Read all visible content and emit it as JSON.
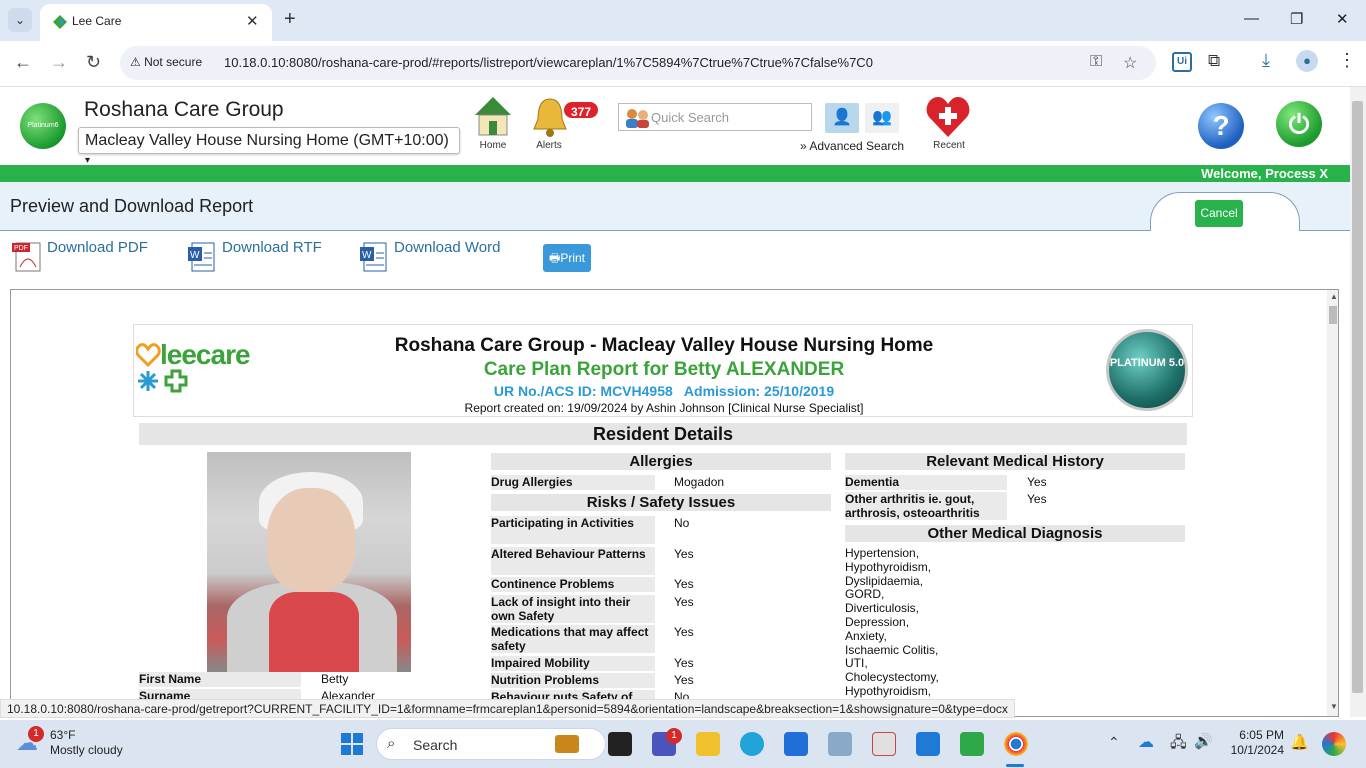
{
  "browser": {
    "tab_title": "Lee Care",
    "not_secure": "Not secure",
    "url": "10.18.0.10:8080/roshana-care-prod/#reports/listreport/viewcareplan/1%7C5894%7Ctrue%7Ctrue%7Cfalse%7C0"
  },
  "header": {
    "logo_text": "Platinum6",
    "org": "Roshana Care Group",
    "facility": "Macleay Valley House Nursing Home (GMT+10:00)",
    "home_label": "Home",
    "alerts_label": "Alerts",
    "alerts_count": "377",
    "quick_search_placeholder": "Quick Search",
    "advanced_search": "» Advanced Search",
    "recent_label": "Recent",
    "welcome": "Welcome, Process X"
  },
  "subheader": {
    "title": "Preview and Download Report",
    "cancel": "Cancel"
  },
  "downloads": {
    "pdf": "Download PDF",
    "rtf": "Download RTF",
    "word": "Download Word",
    "print": "Print"
  },
  "report": {
    "leecare_logo": "leecare",
    "platinum_logo": "PLATINUM 5.0",
    "org_line": "Roshana Care Group - Macleay Valley House Nursing Home",
    "plan_line": "Care Plan Report for Betty ALEXANDER",
    "id_line": "UR No./ACS ID: MCVH4958   Admission: 25/10/2019",
    "created_line": "Report created on: 19/09/2024 by Ashin Johnson [Clinical Nurse Specialist]",
    "section_title": "Resident Details",
    "first_name_label": "First Name",
    "first_name": "Betty",
    "surname_label": "Surname",
    "surname": "Alexander",
    "allergies_title": "Allergies",
    "drug_allergies_label": "Drug Allergies",
    "drug_allergies": "Mogadon",
    "risks_title": "Risks / Safety Issues",
    "risks": [
      {
        "label": "Participating in Activities",
        "value": "No"
      },
      {
        "label": "Altered Behaviour Patterns",
        "value": "Yes"
      },
      {
        "label": "Continence Problems",
        "value": "Yes"
      },
      {
        "label": "Lack of insight into their own Safety",
        "value": "Yes"
      },
      {
        "label": "Medications that may affect safety",
        "value": "Yes"
      },
      {
        "label": "Impaired Mobility",
        "value": "Yes"
      },
      {
        "label": "Nutrition Problems",
        "value": "Yes"
      },
      {
        "label": "Behaviour puts Safety of",
        "value": "No"
      }
    ],
    "history_title": "Relevant Medical History",
    "history": [
      {
        "label": "Dementia",
        "value": "Yes"
      },
      {
        "label": "Other arthritis ie. gout, arthrosis, osteoarthritis",
        "value": "Yes"
      }
    ],
    "other_dx_title": "Other Medical Diagnosis",
    "other_dx": [
      "Hypertension,",
      "Hypothyroidism,",
      "Dyslipidaemia,",
      "GORD,",
      "Diverticulosis,",
      "Depression,",
      "Anxiety,",
      "Ischaemic Colitis,",
      "UTI,",
      "Cholecystectomy,",
      "Hypothyroidism,"
    ]
  },
  "status_url": "10.18.0.10:8080/roshana-care-prod/getreport?CURRENT_FACILITY_ID=1&formname=frmcareplan1&personid=5894&orientation=landscape&breaksection=1&showsignature=0&type=docx",
  "taskbar": {
    "temp": "63°F",
    "weather": "Mostly cloudy",
    "weather_badge": "1",
    "search": "Search",
    "teams_badge": "1",
    "time": "6:05 PM",
    "date": "10/1/2024"
  },
  "colors": {
    "brand_green": "#28b24b",
    "link_blue": "#2a6fa0",
    "alert_red": "#e0212b"
  }
}
